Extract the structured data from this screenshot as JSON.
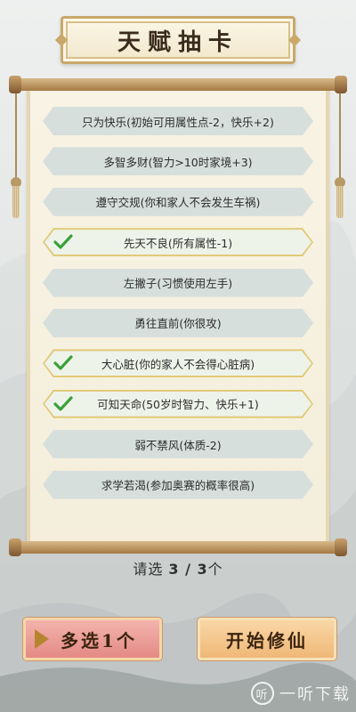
{
  "title": "天赋抽卡",
  "talents": [
    {
      "label": "只为快乐(初始可用属性点-2，快乐+2)",
      "selected": false
    },
    {
      "label": "多智多财(智力>10时家境+3)",
      "selected": false
    },
    {
      "label": "遵守交规(你和家人不会发生车祸)",
      "selected": false
    },
    {
      "label": "先天不良(所有属性-1)",
      "selected": true
    },
    {
      "label": "左撇子(习惯使用左手)",
      "selected": false
    },
    {
      "label": "勇往直前(你很攻)",
      "selected": false
    },
    {
      "label": "大心脏(你的家人不会得心脏病)",
      "selected": true
    },
    {
      "label": "可知天命(50岁时智力、快乐+1)",
      "selected": true
    },
    {
      "label": "弱不禁风(体质-2)",
      "selected": false
    },
    {
      "label": "求学若渴(参加奥赛的概率很高)",
      "selected": false
    }
  ],
  "selection": {
    "prefix": "请选 ",
    "count": "3 / 3",
    "suffix": "个"
  },
  "buttons": {
    "multi": "多选1个",
    "start": "开始修仙"
  },
  "watermark": {
    "logo": "听",
    "text": "一听下载"
  },
  "colors": {
    "check": "#3aa13a",
    "selected_border": "#e2c978",
    "accent": "#c9a86a"
  }
}
